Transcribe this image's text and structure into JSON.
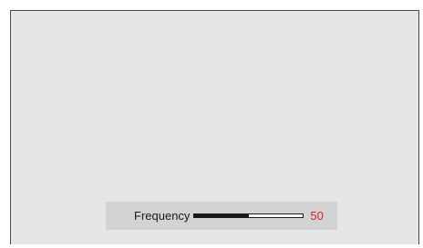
{
  "osd": {
    "label": "Frequency",
    "value": "50",
    "level_percent": 50,
    "value_color": "#e02020"
  }
}
